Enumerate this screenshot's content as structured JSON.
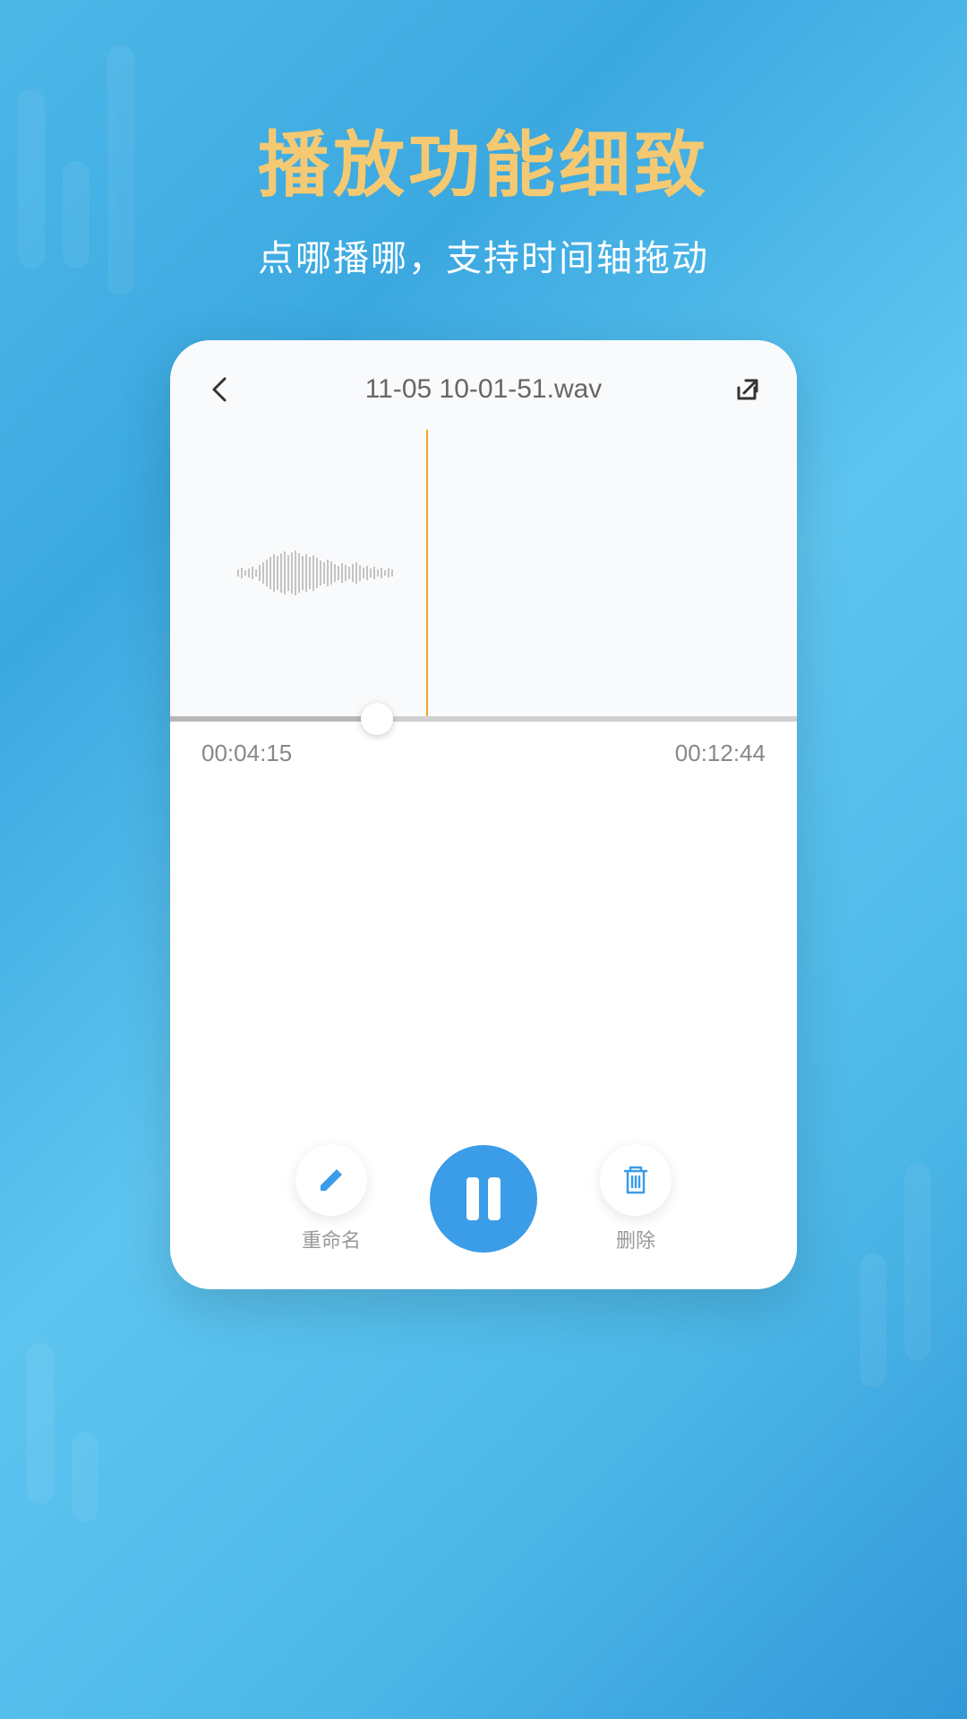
{
  "promo": {
    "title": "播放功能细致",
    "subtitle": "点哪播哪，支持时间轴拖动"
  },
  "app": {
    "filename": "11-05 10-01-51.wav",
    "currentTime": "00:04:15",
    "totalTime": "00:12:44",
    "sliderPosition": 33,
    "controls": {
      "rename": "重命名",
      "delete": "删除"
    }
  },
  "colors": {
    "accent": "#3b9ce8",
    "titleGold": "#f5c971",
    "playhead": "#f5a623"
  }
}
